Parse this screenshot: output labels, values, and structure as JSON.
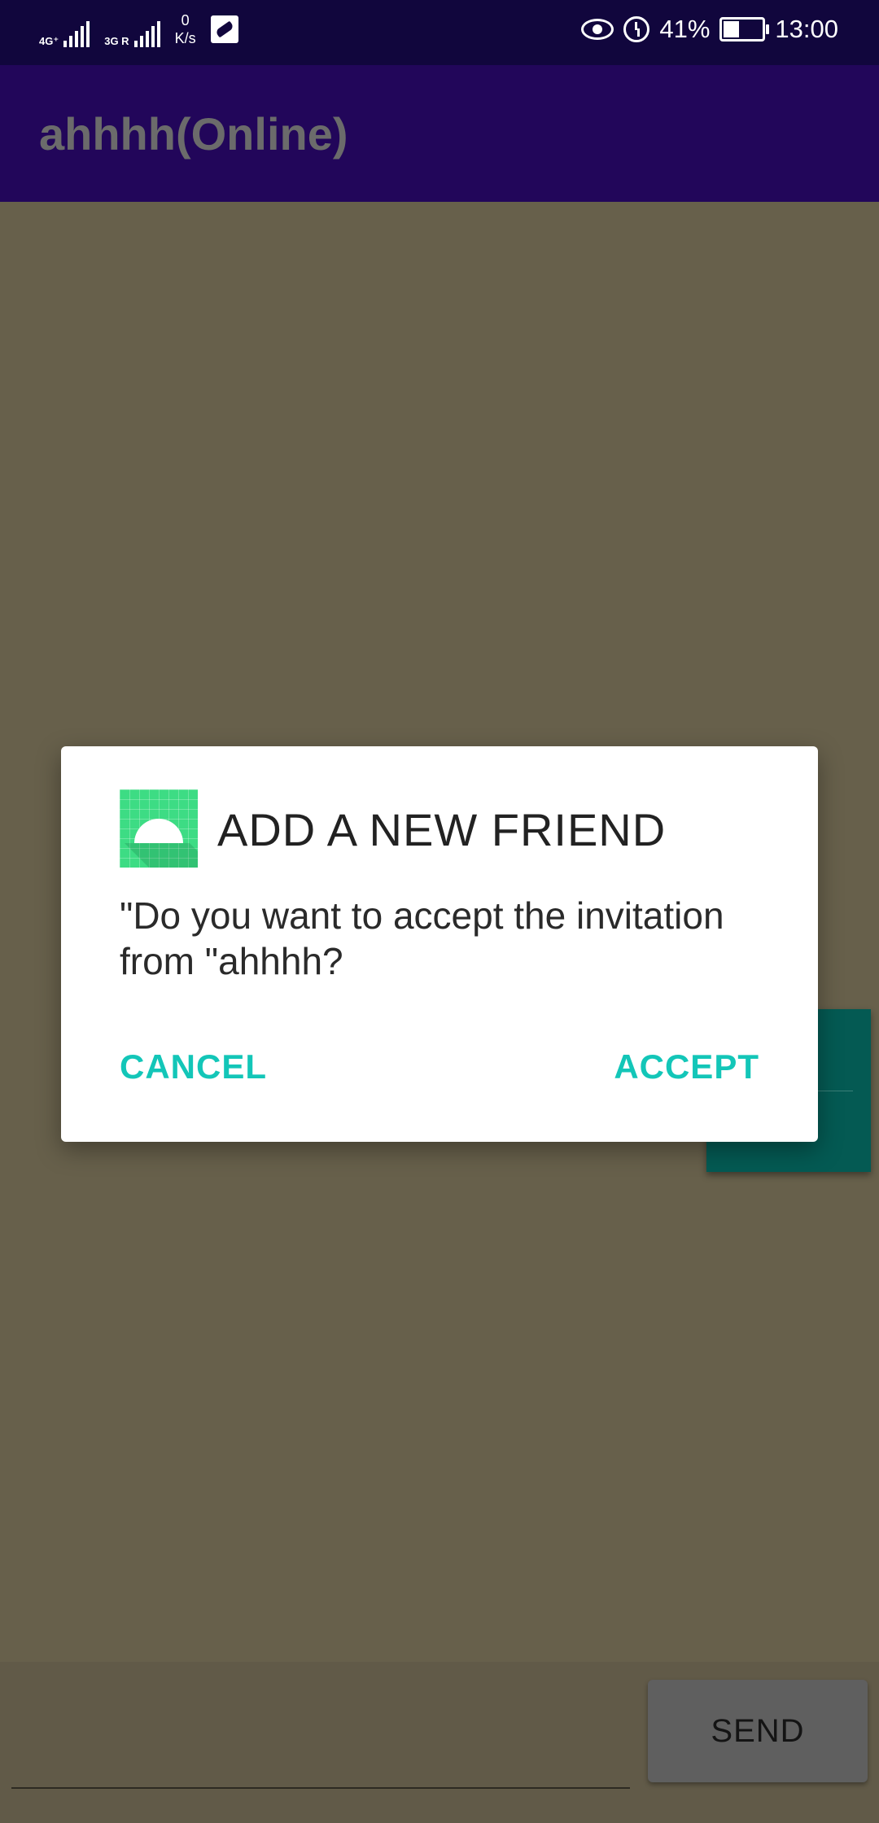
{
  "status_bar": {
    "network1": "4G⁺",
    "network2": "3G R",
    "speed_value": "0",
    "speed_unit": "K/s",
    "battery_percent": "41%",
    "time": "13:00"
  },
  "app_bar": {
    "title": "ahhhh(Online)"
  },
  "dialog": {
    "icon": "android-app-icon",
    "title": "ADD A NEW FRIEND",
    "message": "\"Do you want to accept the invitation from \"ahhhh?",
    "cancel_label": "CANCEL",
    "accept_label": "ACCEPT"
  },
  "composer": {
    "input_value": "",
    "send_label": "SEND"
  },
  "colors": {
    "status_bar": "#11063d",
    "app_bar": "#22065a",
    "dim_background": "#67604b",
    "dialog_accent": "#13c6b8"
  }
}
